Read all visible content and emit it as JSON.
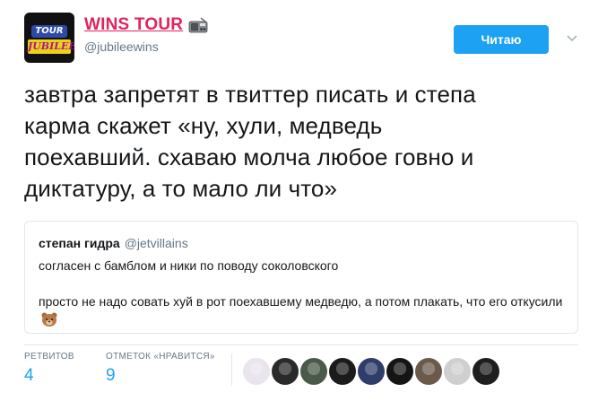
{
  "header": {
    "display_name": "WINS TOUR",
    "handle": "@jubileewins",
    "avatar": {
      "top_text": "TOUR",
      "bottom_text": "JUBILEE"
    },
    "name_emoji": "radio-icon"
  },
  "follow_button": {
    "label": "Читаю"
  },
  "tweet": {
    "lines": [
      "завтра запретят в твиттер писать и степа",
      "карма скажет «ну, хули, медведь",
      "поехавший. схаваю молча любое говно и",
      "диктатуру, а то мало ли что»"
    ]
  },
  "quoted_tweet": {
    "name": "степан гидра",
    "handle": "@jetvillains",
    "line1": "согласен с бамблом и ники по поводу соколовского",
    "line2": "просто не надо совать хуй в рот поехавшему медведю, а потом плакать, что его откусили",
    "emoji": "bear-face-icon"
  },
  "stats": {
    "retweets_label": "РЕТВИТОВ",
    "retweets_value": "4",
    "likes_label": "ОТМЕТОК «НРАВИТСЯ»",
    "likes_value": "9"
  },
  "likers": {
    "colors": [
      "#e9e4ee",
      "#2a2a2a",
      "#4a5a4a",
      "#1b1b1b",
      "#2f3d6b",
      "#151515",
      "#6b5a4a",
      "#cfcfcf",
      "#1e1e1e"
    ]
  }
}
